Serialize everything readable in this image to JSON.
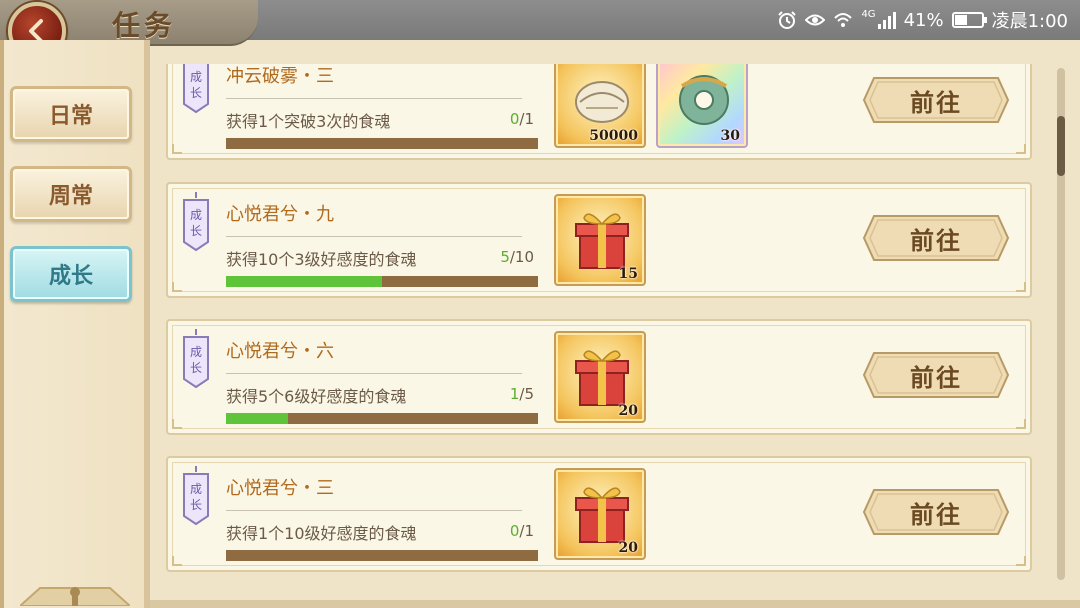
{
  "header": {
    "title": "任务",
    "back_icon": "back-arrow-icon"
  },
  "status_bar": {
    "battery": "41%",
    "time": "凌晨1:00",
    "network": "4G",
    "icons": [
      "alarm-icon",
      "eye-icon",
      "wifi-icon",
      "signal-icon",
      "battery-icon"
    ]
  },
  "tabs": [
    {
      "label": "日常",
      "active": false
    },
    {
      "label": "周常",
      "active": false
    },
    {
      "label": "成长",
      "active": true
    }
  ],
  "tasks": [
    {
      "tag": "成长",
      "name": "冲云破雾・三",
      "desc": "获得1个突破3次的食魂",
      "current": "0",
      "total": "/1",
      "progress": 0,
      "rewards": [
        {
          "icon": "shell-coin-icon",
          "qty": "50000",
          "style": "gold"
        },
        {
          "icon": "jade-ring-icon",
          "qty": "30",
          "style": "rainbow"
        }
      ],
      "button": "前往"
    },
    {
      "tag": "成长",
      "name": "心悦君兮・九",
      "desc": "获得10个3级好感度的食魂",
      "current": "5",
      "total": "/10",
      "progress": 0.5,
      "rewards": [
        {
          "icon": "gift-box-icon",
          "qty": "15",
          "style": "gold"
        }
      ],
      "button": "前往"
    },
    {
      "tag": "成长",
      "name": "心悦君兮・六",
      "desc": "获得5个6级好感度的食魂",
      "current": "1",
      "total": "/5",
      "progress": 0.2,
      "rewards": [
        {
          "icon": "gift-box-icon",
          "qty": "20",
          "style": "gold"
        }
      ],
      "button": "前往"
    },
    {
      "tag": "成长",
      "name": "心悦君兮・三",
      "desc": "获得1个10级好感度的食魂",
      "current": "0",
      "total": "/1",
      "progress": 0,
      "rewards": [
        {
          "icon": "gift-box-icon",
          "qty": "20",
          "style": "gold"
        }
      ],
      "button": "前往"
    }
  ],
  "colors": {
    "progress_fill": "#5fc43a",
    "progress_track": "#8f6b42",
    "active_tab": "#9fdbe2",
    "task_name": "#b06a1e"
  }
}
